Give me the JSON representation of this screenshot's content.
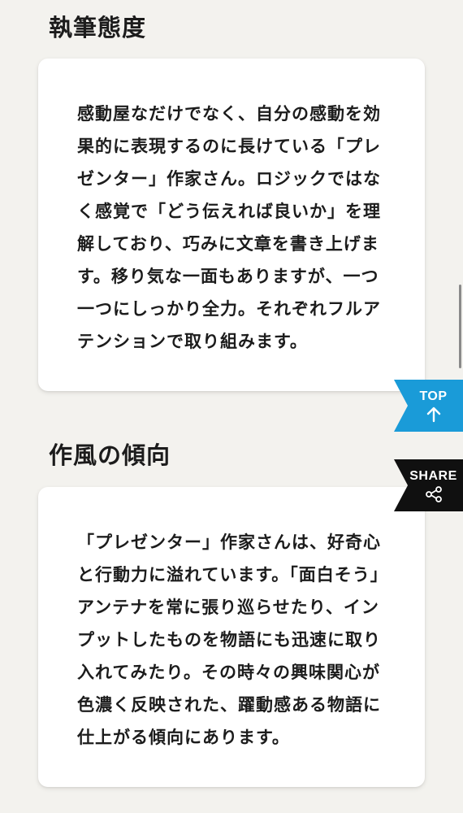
{
  "sections": [
    {
      "heading": "執筆態度",
      "body": "感動屋なだけでなく、自分の感動を効果的に表現するのに長けている「プレゼンター」作家さん。ロジックではなく感覚で「どう伝えれば良いか」を理解しており、巧みに文章を書き上げます。移り気な一面もありますが、一つ一つにしっかり全力。それぞれフルアテンションで取り組みます。"
    },
    {
      "heading": "作風の傾向",
      "body": "「プレゼンター」作家さんは、好奇心と行動力に溢れています。「面白そう」アンテナを常に張り巡らせたり、インプットしたものを物語にも迅速に取り入れてみたり。その時々の興味関心が色濃く反映された、躍動感ある物語に仕上がる傾向にあります。"
    }
  ],
  "floating_buttons": {
    "top_label": "TOP",
    "top_icon": "arrow-up-icon",
    "top_color": "#1a9bd8",
    "share_label": "SHARE",
    "share_icon": "share-icon",
    "share_color": "#101010"
  },
  "colors": {
    "page_background": "#f3f2ee",
    "card_background": "#ffffff",
    "text": "#1c1c1c"
  }
}
